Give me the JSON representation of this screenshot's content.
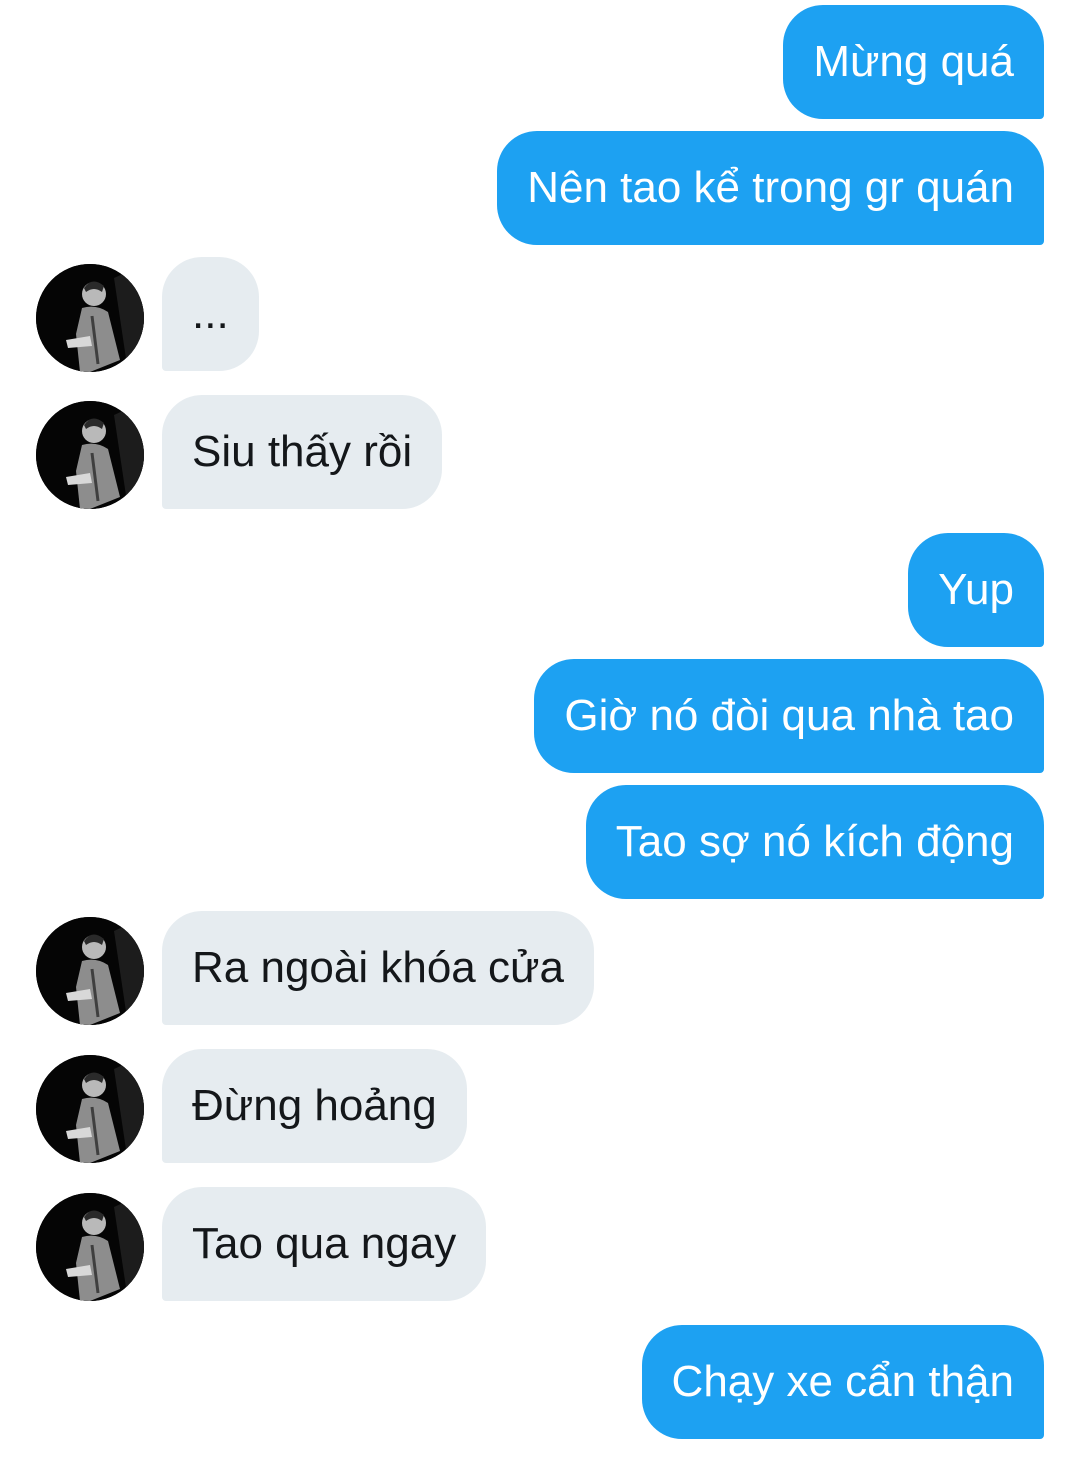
{
  "messages": [
    {
      "side": "out",
      "text": "Mừng quá"
    },
    {
      "side": "out",
      "text": "Nên tao kể trong gr quán"
    },
    {
      "side": "in",
      "text": "..."
    },
    {
      "side": "in",
      "text": "Siu thấy rồi"
    },
    {
      "side": "out",
      "text": "Yup"
    },
    {
      "side": "out",
      "text": "Giờ nó đòi qua nhà tao"
    },
    {
      "side": "out",
      "text": "Tao sợ nó kích động"
    },
    {
      "side": "in",
      "text": "Ra ngoài khóa cửa"
    },
    {
      "side": "in",
      "text": "Đừng hoảng"
    },
    {
      "side": "in",
      "text": "Tao qua ngay"
    },
    {
      "side": "out",
      "text": "Chạy xe cẩn thận"
    }
  ],
  "colors": {
    "outgoing_bubble": "#1da1f2",
    "incoming_bubble": "#e6ecf0",
    "outgoing_text": "#ffffff",
    "incoming_text": "#14171a"
  },
  "avatar_icon": "user-photo-avatar"
}
